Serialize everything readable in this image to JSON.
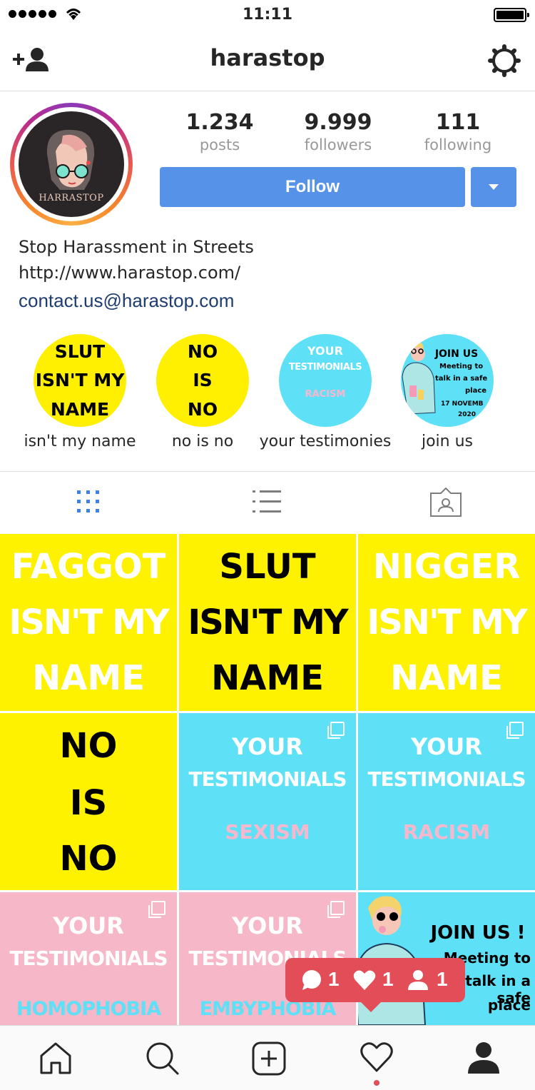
{
  "status_bar": {
    "time": "11:11"
  },
  "header": {
    "username": "harastop"
  },
  "profile": {
    "avatar_text": "HARRASTOP",
    "stats": [
      {
        "value": "1.234",
        "label": "posts"
      },
      {
        "value": "9.999",
        "label": "followers"
      },
      {
        "value": "111",
        "label": "following"
      }
    ],
    "follow_label": "Follow",
    "bio_line1": "Stop Harassment in Streets",
    "bio_line2": "http://www.harastop.com/",
    "email": "contact.us@harastop.com"
  },
  "highlights": [
    {
      "label": "isn't my name",
      "lines": [
        "SLUT",
        "ISN'T MY",
        "NAME"
      ]
    },
    {
      "label": "no is no",
      "lines": [
        "NO",
        "IS",
        "NO"
      ]
    },
    {
      "label": "your testimonies",
      "lines": [
        "YOUR",
        "TESTIMONIALS",
        "RACISM"
      ]
    },
    {
      "label": "join us",
      "lines": [
        "JOIN US",
        "Meeting to",
        "talk in a safe",
        "place",
        "17 NOVEMB",
        "2020"
      ]
    }
  ],
  "posts": [
    {
      "lines": [
        "FAGGOT",
        "ISN'T MY",
        "NAME"
      ]
    },
    {
      "lines": [
        "SLUT",
        "ISN'T MY",
        "NAME"
      ]
    },
    {
      "lines": [
        "NIGGER",
        "ISN'T MY",
        "NAME"
      ]
    },
    {
      "lines": [
        "NO",
        "IS",
        "NO"
      ]
    },
    {
      "lines": [
        "YOUR",
        "TESTIMONIALS",
        "SEXISM"
      ]
    },
    {
      "lines": [
        "YOUR",
        "TESTIMONIALS",
        "RACISM"
      ]
    },
    {
      "lines": [
        "YOUR",
        "TESTIMONIALS",
        "HOMOPHOBIA"
      ]
    },
    {
      "lines": [
        "YOUR",
        "TESTIMONIALS",
        "EMBYPHOBIA"
      ]
    },
    {
      "lines": [
        "JOIN US !",
        "Meeting to",
        "talk in a safe",
        "place"
      ]
    }
  ],
  "activity": {
    "comments": "1",
    "likes": "1",
    "follows": "1"
  },
  "colors": {
    "yellow": "#fff200",
    "cyan": "#5ee1f6",
    "pink": "#f6b7c9",
    "follow_blue": "#5592e8",
    "activity_red": "#e34d58"
  }
}
